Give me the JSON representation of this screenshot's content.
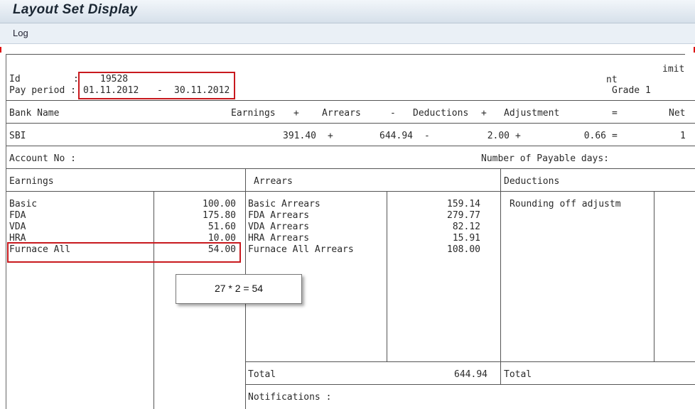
{
  "window": {
    "title": "Layout Set Display"
  },
  "menu": {
    "items": [
      "Log"
    ]
  },
  "header": {
    "id_label": "Id",
    "id_sep": ":",
    "id_value": "19528",
    "pay_period_label": "Pay period :",
    "pay_period_from": "01.11.2012",
    "pay_period_dash": "-",
    "pay_period_to": "30.11.2012",
    "right_frag_1": "imit",
    "right_frag_2": "nt",
    "grade": "Grade 1"
  },
  "bank_summary": {
    "headers": [
      "Bank Name",
      "Earnings",
      "+",
      "Arrears",
      "-",
      "Deductions",
      "+",
      "Adjustment",
      "=",
      "Net"
    ],
    "row": {
      "bank": "SBI",
      "earnings": "391.40",
      "plus1": "+",
      "arrears": "644.94",
      "minus": "-",
      "deductions": "2.00",
      "plus2": "+",
      "adjustment": "0.66",
      "equals": "=",
      "net": "1"
    }
  },
  "account": {
    "account_label": "Account No :",
    "payable_days_label": "Number of Payable days:"
  },
  "sections": {
    "earnings": "Earnings",
    "arrears": "Arrears",
    "deductions": "Deductions"
  },
  "earnings": [
    {
      "name": "Basic",
      "amount": "100.00"
    },
    {
      "name": "FDA",
      "amount": "175.80"
    },
    {
      "name": "VDA",
      "amount": "51.60"
    },
    {
      "name": "HRA",
      "amount": "10.00"
    },
    {
      "name": "Furnace All",
      "amount": "54.00"
    }
  ],
  "arrears": [
    {
      "name": "Basic Arrears",
      "amount": "159.14"
    },
    {
      "name": "FDA Arrears",
      "amount": "279.77"
    },
    {
      "name": "VDA Arrears",
      "amount": "82.12"
    },
    {
      "name": "HRA Arrears",
      "amount": "15.91"
    },
    {
      "name": "Furnace All Arrears",
      "amount": "108.00"
    }
  ],
  "deductions": [
    {
      "name": "Rounding off adjustm"
    }
  ],
  "totals": {
    "arrears_label": "Total",
    "arrears_value": "644.94",
    "deductions_label": "Total"
  },
  "notifications": {
    "label": "Notifications :"
  },
  "annotation": {
    "text": "27 * 2 = 54"
  },
  "colors": {
    "highlight_box": "#c8191e",
    "title_bar": "#dbe4ed"
  }
}
